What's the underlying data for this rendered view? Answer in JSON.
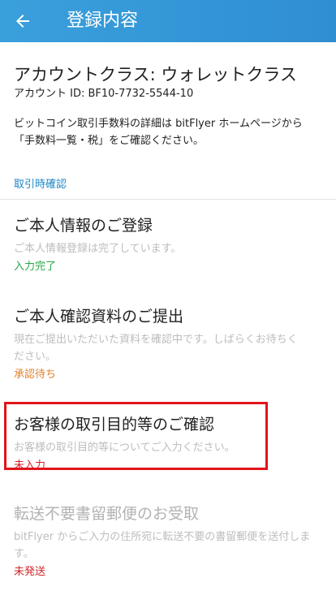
{
  "header": {
    "title": "登録内容",
    "back_icon": "arrow-left-icon",
    "background_color": "#3aa0dc"
  },
  "account": {
    "class_line": "アカウントクラス: ウォレットクラス",
    "id_line": "アカウント ID: BF10-7732-5544-10"
  },
  "fee_notice": {
    "line1": "ビットコイン取引手数料の詳細は bitFlyer ホームページから",
    "line2": "「手数料一覧・税」をご確認ください。"
  },
  "section": {
    "label": "取引時確認"
  },
  "items": [
    {
      "title": "ご本人情報のご登録",
      "desc_lines": [
        "ご本人情報登録は完了しています。"
      ],
      "status": "入力完了",
      "status_color": "#27a745"
    },
    {
      "title": "ご本人確認資料のご提出",
      "desc_lines": [
        "現在ご提出いただいた資料を確認中です。しばらくお待ちく",
        "ださい。"
      ],
      "status": "承認待ち",
      "status_color": "#e0822c"
    },
    {
      "title": "お客様の取引目的等のご確認",
      "desc_lines": [
        "お客様の取引目的等についてご入力ください。"
      ],
      "status": "未入力",
      "status_color": "#d0262b",
      "highlighted": true,
      "highlight_color": "#e3141c"
    },
    {
      "title": "転送不要書留郵便のお受取",
      "desc_lines": [
        "bitFlyer からご入力の住所宛に転送不要の書留郵便を送付しま",
        "す。"
      ],
      "status": "未発送",
      "status_color": "#d0262b",
      "disabled": true
    }
  ]
}
